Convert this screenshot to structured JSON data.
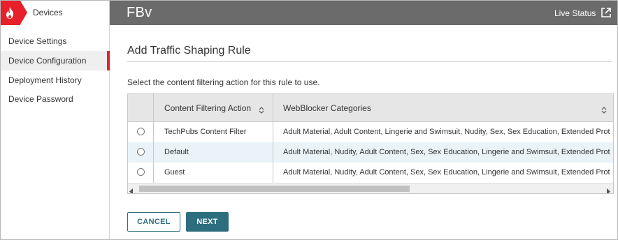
{
  "brand": {
    "label": "Devices",
    "logo_icon": "firebox-flame-logo",
    "accent": "#e8202a"
  },
  "header": {
    "device_name": "FBv",
    "live_status": "Live Status",
    "external_icon": "external-link-icon"
  },
  "sidebar": {
    "items": [
      {
        "label": "Device Settings",
        "active": false
      },
      {
        "label": "Device Configuration",
        "active": true
      },
      {
        "label": "Deployment History",
        "active": false
      },
      {
        "label": "Device Password",
        "active": false
      }
    ]
  },
  "main": {
    "title": "Add Traffic Shaping Rule",
    "instruction": "Select the content filtering action for this rule to use.",
    "table": {
      "columns": [
        "Content Filtering Action",
        "WebBlocker Categories"
      ],
      "rows": [
        {
          "action": "TechPubs Content Filter",
          "categories": "Adult Material, Adult Content, Lingerie and Swimsuit, Nudity, Sex, Sex Education, Extended Prote..."
        },
        {
          "action": "Default",
          "categories": "Adult Material, Nudity, Adult Content, Sex, Sex Education, Lingerie and Swimsuit, Extended Prote..."
        },
        {
          "action": "Guest",
          "categories": "Adult Material, Nudity, Adult Content, Sex, Sex Education, Lingerie and Swimsuit, Extended Prote..."
        }
      ]
    },
    "buttons": {
      "cancel": "CANCEL",
      "next": "NEXT"
    }
  },
  "colors": {
    "topbar": "#6b6b6b",
    "primary": "#2d6e7e",
    "row_highlight": "#eaf3f8"
  }
}
